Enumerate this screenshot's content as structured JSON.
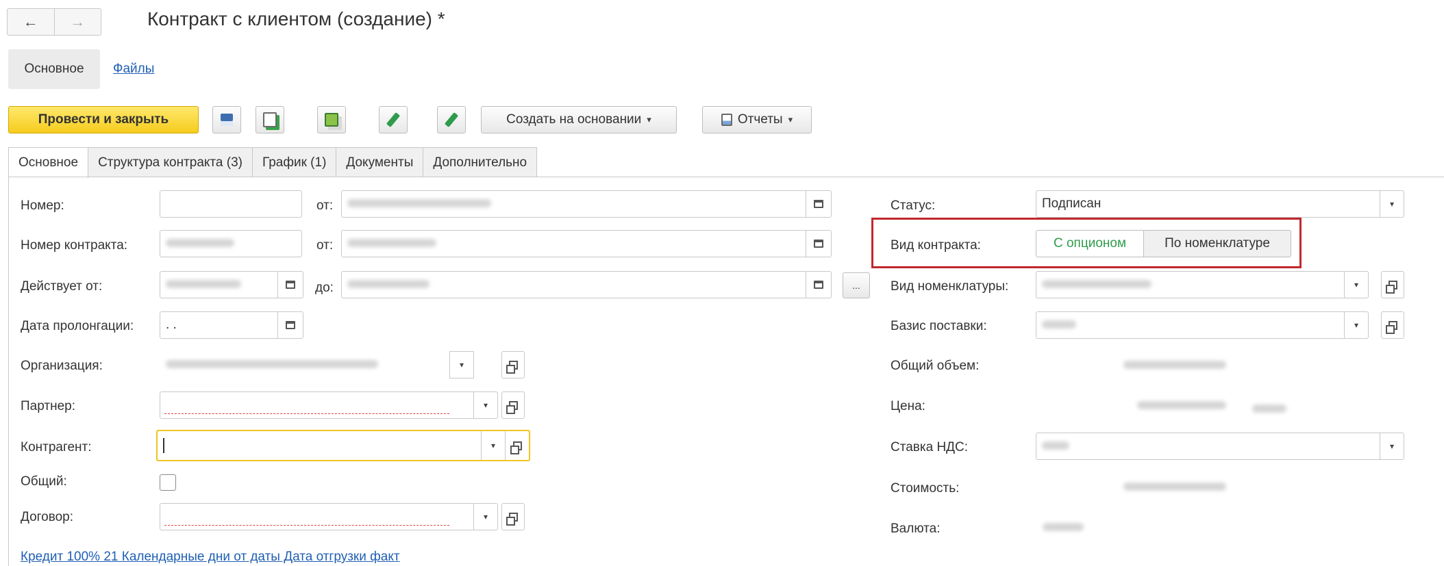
{
  "header": {
    "back_icon": "arrow-left-icon",
    "forward_icon": "arrow-right-icon",
    "back_glyph": "←",
    "forward_glyph": "→",
    "title": "Контракт с клиентом (создание) *"
  },
  "subtabs": {
    "active": "Основное",
    "link": "Файлы"
  },
  "toolbar": {
    "post_close": "Провести и закрыть",
    "create_based_on": "Создать на основании",
    "reports": "Отчеты",
    "caret": "▾",
    "icons": [
      "save-icon",
      "post-icon",
      "copy-icon",
      "sign-icon",
      "sign-check-icon",
      "reports-icon"
    ]
  },
  "tabs": [
    "Основное",
    "Структура контракта (3)",
    "График (1)",
    "Документы",
    "Дополнительно"
  ],
  "form": {
    "number_label": "Номер:",
    "from_label": "от:",
    "contract_number_label": "Номер контракта:",
    "valid_from_label": "Действует от:",
    "to_label": "до:",
    "extension_date_label": "Дата пролонгации:",
    "extension_date_value": " .  .",
    "organization_label": "Организация:",
    "partner_label": "Партнер:",
    "counterparty_label": "Контрагент:",
    "common_label": "Общий:",
    "agreement_label": "Договор:",
    "more_button": "...",
    "status_label": "Статус:",
    "status_value": "Подписан",
    "contract_type_label": "Вид контракта:",
    "contract_type_options": [
      "С опционом",
      "По номенклатуре"
    ],
    "nomenclature_type_label": "Вид номенклатуры:",
    "delivery_basis_label": "Базис поставки:",
    "total_volume_label": "Общий объем:",
    "price_label": "Цена:",
    "vat_rate_label": "Ставка НДС:",
    "cost_label": "Стоимость:",
    "currency_label": "Валюта:"
  },
  "payment_terms_link": "Кредит 100% 21 Календарные дни от даты Дата отгрузки факт",
  "colors": {
    "primary_button": "#f5cc1e",
    "link": "#1f5fb4",
    "highlight_box": "#c0282d",
    "active_option": "#2e9c4b",
    "focus_border": "#f0c420"
  }
}
